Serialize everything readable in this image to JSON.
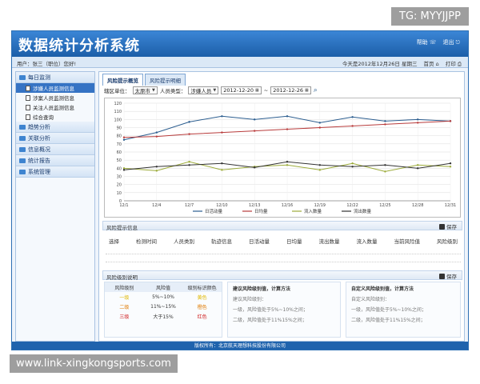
{
  "watermark": {
    "tg": "TG: MYYJJPP",
    "url": "www.link-xingkongsports.com"
  },
  "header": {
    "title": "数据统计分析系统",
    "help": "帮助",
    "logout": "退出"
  },
  "infobar": {
    "user": "用户：张三（职位）您好!",
    "date": "今天是2012年12月26日 星期三",
    "home": "首页",
    "print": "打印"
  },
  "sidebar": {
    "items": [
      {
        "label": "每日监测",
        "children": [
          {
            "label": "涉嫌人员监测信息",
            "active": true
          },
          {
            "label": "涉案人员监测信息"
          },
          {
            "label": "关注人员监测信息"
          },
          {
            "label": "综合查询"
          }
        ]
      },
      {
        "label": "趋势分析"
      },
      {
        "label": "关联分析"
      },
      {
        "label": "信息概况"
      },
      {
        "label": "统计报告"
      },
      {
        "label": "系统管理"
      }
    ]
  },
  "tabs": [
    "风险提示概览",
    "风险提示明细"
  ],
  "filter": {
    "region_label": "辖区单位：",
    "region_value": "太原市",
    "type_label": "人员类型：",
    "type_value": "涉嫌人员",
    "date_from": "2012-12-20",
    "date_to": "2012-12-26",
    "separator": "~"
  },
  "chart_data": {
    "type": "line",
    "x": [
      "12/1",
      "12/4",
      "12/7",
      "12/10",
      "12/13",
      "12/16",
      "12/19",
      "12/22",
      "12/25",
      "12/28",
      "12/31"
    ],
    "ylim": [
      0,
      120
    ],
    "yticks": [
      0,
      10,
      20,
      30,
      40,
      50,
      60,
      70,
      80,
      90,
      100,
      110,
      120
    ],
    "series": [
      {
        "name": "日活动量",
        "color": "#2b5d8f",
        "values": [
          75,
          84,
          97,
          104,
          100,
          104,
          96,
          103,
          98,
          100,
          98
        ]
      },
      {
        "name": "日均量",
        "color": "#b83b3b",
        "values": [
          78,
          79,
          82,
          84,
          86,
          88,
          90,
          92,
          94,
          96,
          98
        ]
      },
      {
        "name": "流入数量",
        "color": "#9cab3a",
        "values": [
          40,
          37,
          48,
          38,
          42,
          44,
          38,
          46,
          36,
          44,
          42
        ]
      },
      {
        "name": "流出数量",
        "color": "#333333",
        "values": [
          38,
          42,
          44,
          46,
          41,
          48,
          44,
          42,
          44,
          40,
          46
        ]
      }
    ]
  },
  "risk_info": {
    "title": "风险提示信息",
    "save": "保存",
    "columns": [
      "选择",
      "检测时间",
      "人员类别",
      "轨迹信息",
      "日活动量",
      "日均量",
      "流出数量",
      "流入数量",
      "当前风险值",
      "风险级别"
    ]
  },
  "level_info": {
    "title": "风险级别说明",
    "save": "保存",
    "table_headers": [
      "风险级别",
      "风险值",
      "级别标识颜色"
    ],
    "rows": [
      {
        "level": "一级",
        "value": "5%~10%",
        "color_name": "黄色",
        "color": "#e0b800"
      },
      {
        "level": "二级",
        "value": "11%~15%",
        "color_name": "橙色",
        "color": "#e07a00"
      },
      {
        "level": "三级",
        "value": "大于15%",
        "color_name": "红色",
        "color": "#d02020"
      }
    ],
    "suggest_title": "建议风险级别值，计算方法",
    "suggest_lines": [
      "建议风险级别：",
      "一级，风险值处于5%~10%之间；",
      "二级，风险值处于11%15%之间；"
    ],
    "custom_title": "自定义风险级别值，计算方法",
    "custom_lines": [
      "自定义风险级别：",
      "一级，风险值处于5%~10%之间；",
      "二级，风险值处于11%15%之间；"
    ]
  },
  "footer": "版权所有：北京航天理想科技股份有限公司"
}
